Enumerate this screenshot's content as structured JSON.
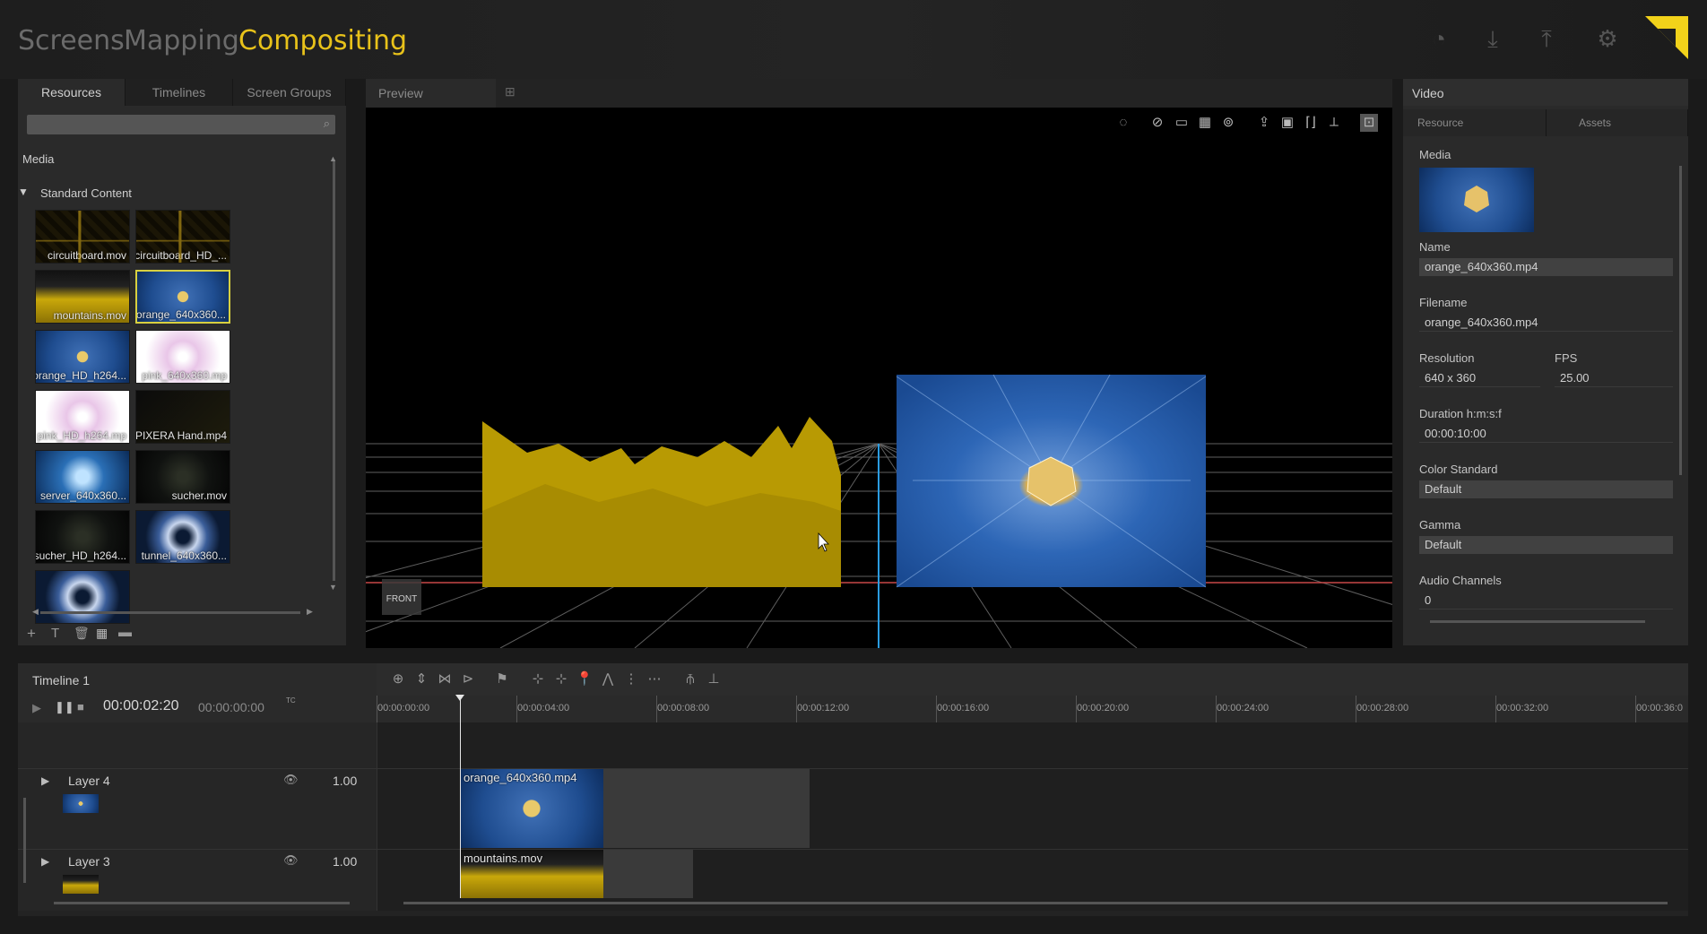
{
  "nav": {
    "tabs": [
      "Screens",
      "Mapping",
      "Compositing"
    ],
    "active": "Compositing",
    "icons": [
      "palette-icon",
      "download-icon",
      "upload-icon",
      "gear-icon"
    ]
  },
  "resources": {
    "tabs": [
      "Resources",
      "Timelines",
      "Screen Groups"
    ],
    "media_label": "Media",
    "folder": "Standard Content",
    "items": [
      {
        "label": "circuitboard.mov",
        "style": "circuit"
      },
      {
        "label": "circuitboard_HD_...",
        "style": "circuit"
      },
      {
        "label": "mountains.mov",
        "style": "mount"
      },
      {
        "label": "orange_640x360...",
        "style": "orange",
        "selected": true
      },
      {
        "label": "orange_HD_h264...",
        "style": "orange"
      },
      {
        "label": "pink_640x360.mp",
        "style": "pink"
      },
      {
        "label": "pink_HD_h264.mp",
        "style": "pink"
      },
      {
        "label": "PIXERA Hand.mp4",
        "style": "pixera"
      },
      {
        "label": "server_640x360...",
        "style": "server"
      },
      {
        "label": "sucher.mov",
        "style": "sucher"
      },
      {
        "label": "sucher_HD_h264...",
        "style": "sucher"
      },
      {
        "label": "tunnel_640x360...",
        "style": "tunnel"
      },
      {
        "label": "",
        "style": "tunnel"
      }
    ]
  },
  "preview": {
    "title": "Preview",
    "front_label": "FRONT"
  },
  "video": {
    "title": "Video",
    "tabs": [
      "Resource",
      "Assets"
    ],
    "media_label": "Media",
    "name_label": "Name",
    "name_value": "orange_640x360.mp4",
    "filename_label": "Filename",
    "filename_value": "orange_640x360.mp4",
    "resolution_label": "Resolution",
    "resolution_value": "640 x 360",
    "fps_label": "FPS",
    "fps_value": "25.00",
    "duration_label": "Duration h:m:s:f",
    "duration_value": "00:00:10:00",
    "color_label": "Color Standard",
    "color_value": "Default",
    "gamma_label": "Gamma",
    "gamma_value": "Default",
    "audio_label": "Audio Channels",
    "audio_value": "0"
  },
  "timeline": {
    "title": "Timeline 1",
    "timecode": "00:00:02:20",
    "timecode2": "00:00:00:00",
    "tc_label": "TC",
    "ruler": [
      "00:00:00:00",
      "00:00:04:00",
      "00:00:08:00",
      "00:00:12:00",
      "00:00:16:00",
      "00:00:20:00",
      "00:00:24:00",
      "00:00:28:00",
      "00:00:32:00",
      "00:00:36:0"
    ],
    "layers": [
      {
        "name": "Layer 4",
        "opacity": "1.00",
        "clip": "orange_640x360.mp4"
      },
      {
        "name": "Layer 3",
        "opacity": "1.00",
        "clip": "mountains.mov"
      }
    ]
  },
  "colors": {
    "accent": "#e8c21a",
    "panel": "#2a2a2a",
    "selection": "#d8d040"
  }
}
